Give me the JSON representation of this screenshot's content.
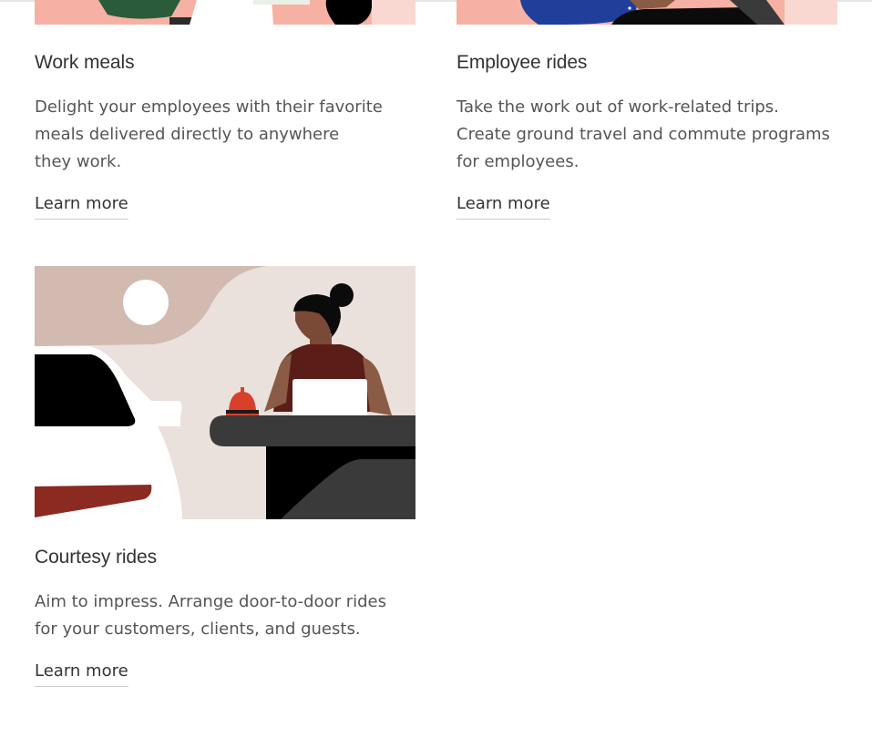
{
  "cards": [
    {
      "title": "Work meals",
      "description": "Delight your employees with their favorite\nmeals delivered directly to anywhere\nthey work.",
      "link": "Learn more"
    },
    {
      "title": "Employee rides",
      "description": "Take the work out of work-related trips.\nCreate ground travel and commute programs\nfor employees.",
      "link": "Learn more"
    },
    {
      "title": "Courtesy rides",
      "description": "Aim to impress. Arrange door-to-door rides\nfor your customers, clients, and guests.",
      "link": "Learn more"
    }
  ],
  "colors": {
    "heading": "#333333",
    "body": "#555555",
    "illustration_bg": "#eae0dc",
    "illustration_pink": "#f6b1a4",
    "dark": "#000000",
    "rust": "#8b2a21"
  },
  "icons": [
    "service-bell-icon"
  ]
}
